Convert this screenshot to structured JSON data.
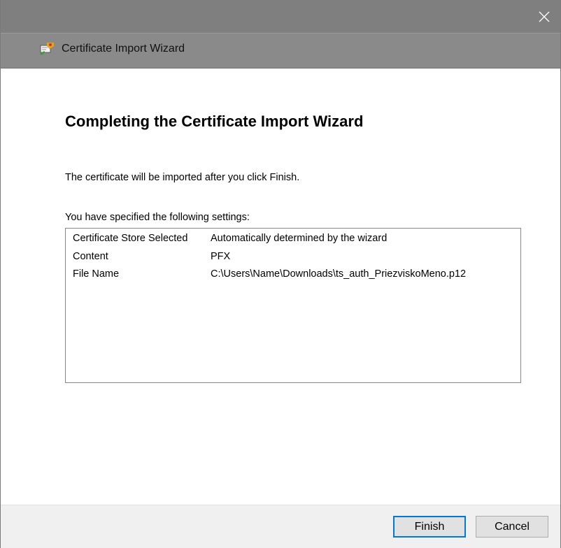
{
  "window": {
    "title": "Certificate Import Wizard"
  },
  "page": {
    "heading": "Completing the Certificate Import Wizard",
    "intro": "The certificate will be imported after you click Finish.",
    "settings_label": "You have specified the following settings:",
    "settings": [
      {
        "key": "Certificate Store Selected",
        "value": "Automatically determined by the wizard"
      },
      {
        "key": "Content",
        "value": "PFX"
      },
      {
        "key": "File Name",
        "value": "C:\\Users\\Name\\Downloads\\ts_auth_PriezviskoMeno.p12"
      }
    ]
  },
  "footer": {
    "finish_label": "Finish",
    "cancel_label": "Cancel"
  },
  "icons": {
    "close": "close-icon",
    "wizard": "certificate-icon"
  },
  "colors": {
    "titlebar": "#7f7f7f",
    "header": "#8a8a8a",
    "default_button_border": "#0078d7",
    "footer": "#f0f0f0"
  }
}
